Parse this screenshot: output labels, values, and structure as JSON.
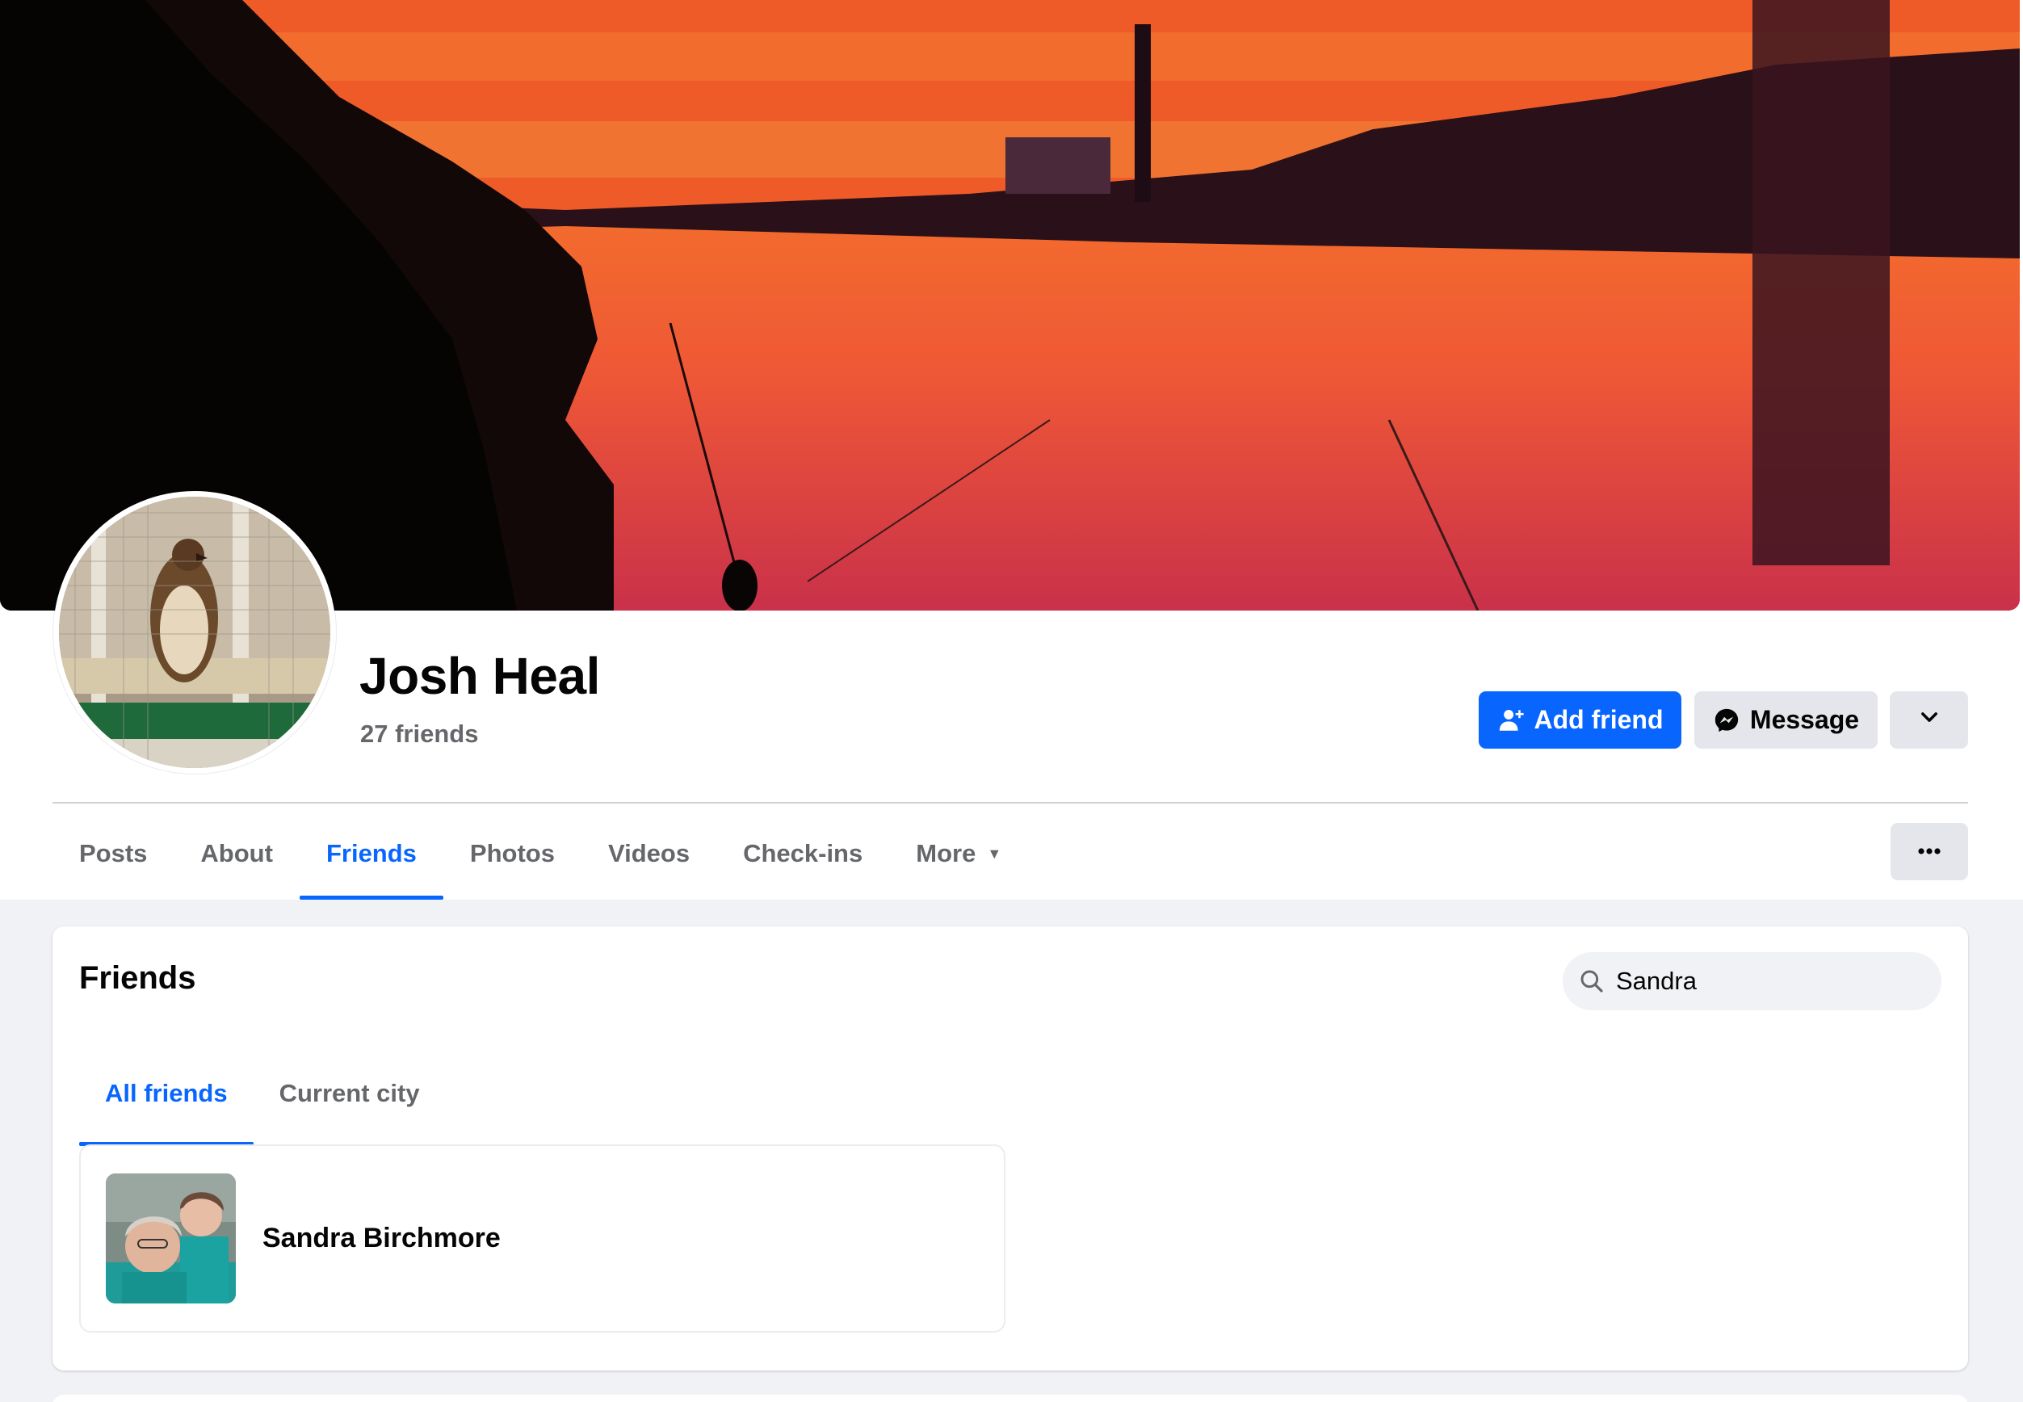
{
  "profile": {
    "name": "Josh Heal",
    "friends_count": "27 friends",
    "cover_alt": "sunset-river-cover",
    "avatar_alt": "hawk-avatar"
  },
  "actions": {
    "add_friend": "Add friend",
    "message": "Message"
  },
  "nav": {
    "tabs": [
      {
        "label": "Posts",
        "active": false
      },
      {
        "label": "About",
        "active": false
      },
      {
        "label": "Friends",
        "active": true
      },
      {
        "label": "Photos",
        "active": false
      },
      {
        "label": "Videos",
        "active": false
      },
      {
        "label": "Check-ins",
        "active": false
      },
      {
        "label": "More",
        "active": false
      }
    ]
  },
  "friends_section": {
    "title": "Friends",
    "search_value": "Sandra",
    "subtabs": [
      {
        "label": "All friends",
        "active": true
      },
      {
        "label": "Current city",
        "active": false
      }
    ],
    "results": [
      {
        "name": "Sandra Birchmore"
      }
    ]
  },
  "colors": {
    "accent": "#0866ff",
    "secondary_button": "#e4e6eb",
    "muted_text": "#65676b",
    "page_bg": "#f0f2f5"
  },
  "icons": {
    "add_friend": "person-plus-icon",
    "message": "messenger-icon",
    "dropdown": "chevron-down-icon",
    "more": "caret-down-icon",
    "overflow": "ellipsis-icon",
    "search": "search-icon"
  }
}
